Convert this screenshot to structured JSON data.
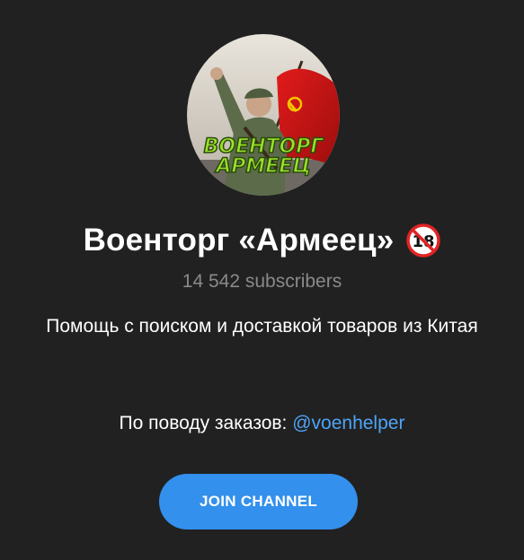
{
  "channel": {
    "title": "Военторг «Армеец»",
    "age_badge": "18",
    "subscribers": "14 542 subscribers",
    "description": "Помощь с поиском и доставкой товаров из Китая",
    "orders_prefix": "По поводу заказов: ",
    "orders_link": "@voenhelper",
    "avatar_text_line1": "ВОЕНТОРГ",
    "avatar_text_line2": "АРМЕЕЦ"
  },
  "actions": {
    "join_label": "JOIN CHANNEL"
  },
  "colors": {
    "background": "#212121",
    "accent": "#3390ec",
    "link": "#4ea4f6",
    "muted_text": "#8a8a8a"
  }
}
